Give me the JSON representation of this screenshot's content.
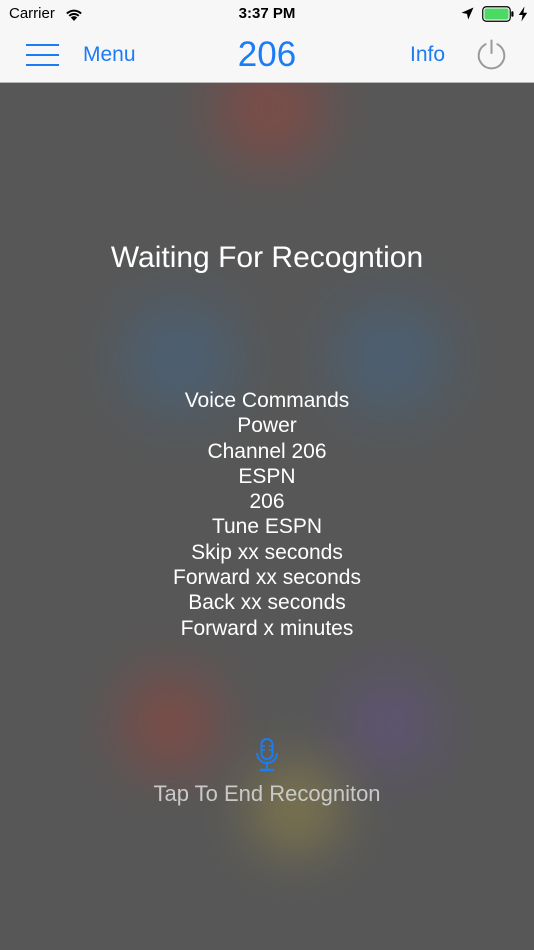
{
  "status_bar": {
    "carrier": "Carrier",
    "time": "3:37 PM",
    "icons": [
      "wifi-icon",
      "location-arrow-icon",
      "battery-icon",
      "charging-bolt-icon"
    ]
  },
  "nav_bar": {
    "menu_label": "Menu",
    "channel": "206",
    "info_label": "Info",
    "icons": [
      "hamburger-icon",
      "power-icon"
    ]
  },
  "recognition": {
    "title": "Waiting For Recogntion",
    "commands": [
      "Voice Commands",
      "Power",
      "Channel 206",
      "ESPN",
      "206",
      "Tune ESPN",
      "Skip xx seconds",
      "Forward xx seconds",
      "Back xx seconds",
      "Forward x minutes"
    ],
    "end_label": "Tap To End Recogniton",
    "icon": "microphone-icon"
  },
  "colors": {
    "accent": "#1c7cf4",
    "overlay": "#575757",
    "battery_green": "#4cd964"
  }
}
